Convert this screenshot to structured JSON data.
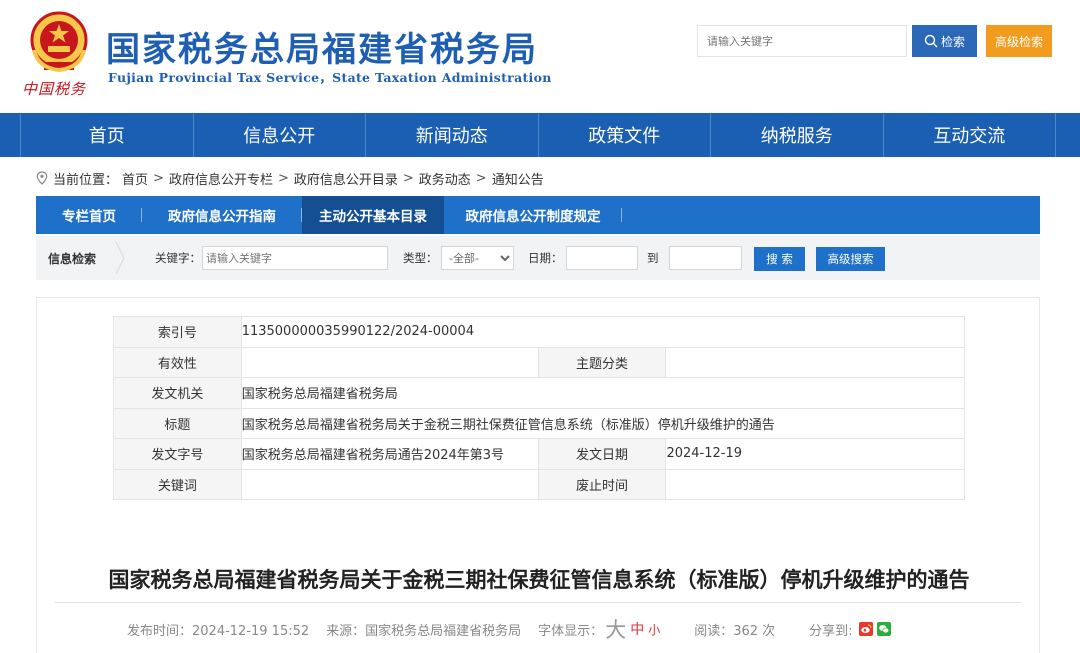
{
  "header": {
    "title": "国家税务总局福建省税务局",
    "subtitle": "Fujian Provincial Tax Service，State Taxation Administration",
    "brush_text": "中国税务",
    "search_placeholder": "请输入关键字",
    "search_button": "检索",
    "advanced_button": "高级检索"
  },
  "nav": [
    "首页",
    "信息公开",
    "新闻动态",
    "政策文件",
    "纳税服务",
    "互动交流"
  ],
  "breadcrumb": {
    "prefix": "当前位置：",
    "items": [
      "首页",
      "政府信息公开专栏",
      "政府信息公开目录",
      "政务动态",
      "通知公告"
    ],
    "separator": ">"
  },
  "subtabs": [
    "专栏首页",
    "政府信息公开指南",
    "主动公开基本目录",
    "政府信息公开制度规定"
  ],
  "filter": {
    "section_label": "信息检索",
    "keyword_label": "关键字：",
    "keyword_placeholder": "请输入关键字",
    "type_label": "类型：",
    "type_selected": "-全部-",
    "date_label": "日期：",
    "to_label": "到",
    "search_button": "搜 索",
    "advanced_button": "高级搜索"
  },
  "meta": {
    "index_label": "索引号",
    "index_value": "113500000035990122/2024-00004",
    "validity_label": "有效性",
    "validity_value": "",
    "topic_label": "主题分类",
    "topic_value": "",
    "issuer_label": "发文机关",
    "issuer_value": "国家税务总局福建省税务局",
    "title_label": "标题",
    "title_value": "国家税务总局福建省税务局关于金税三期社保费征管信息系统（标准版）停机升级维护的通告",
    "docno_label": "发文字号",
    "docno_value": "国家税务总局福建省税务局通告2024年第3号",
    "date_label": "发文日期",
    "date_value": "2024-12-19",
    "keywords_label": "关键词",
    "keywords_value": "",
    "expiry_label": "废止时间",
    "expiry_value": ""
  },
  "article": {
    "title": "国家税务总局福建省税务局关于金税三期社保费征管信息系统（标准版）停机升级维护的通告",
    "publish_time": "发布时间：2024-12-19 15:52",
    "source": "来源：国家税务总局福建省税务局",
    "font_size_label": "字体显示：",
    "font_big": "大",
    "font_mid": "中",
    "font_small": "小",
    "reads": "阅读：362 次",
    "share_label": "分享到:"
  },
  "colors": {
    "brand_blue": "#1e5fb3",
    "nav_blue": "#1b5fb2",
    "tab_active": "#144f94",
    "accent_orange": "#f29c1f"
  }
}
